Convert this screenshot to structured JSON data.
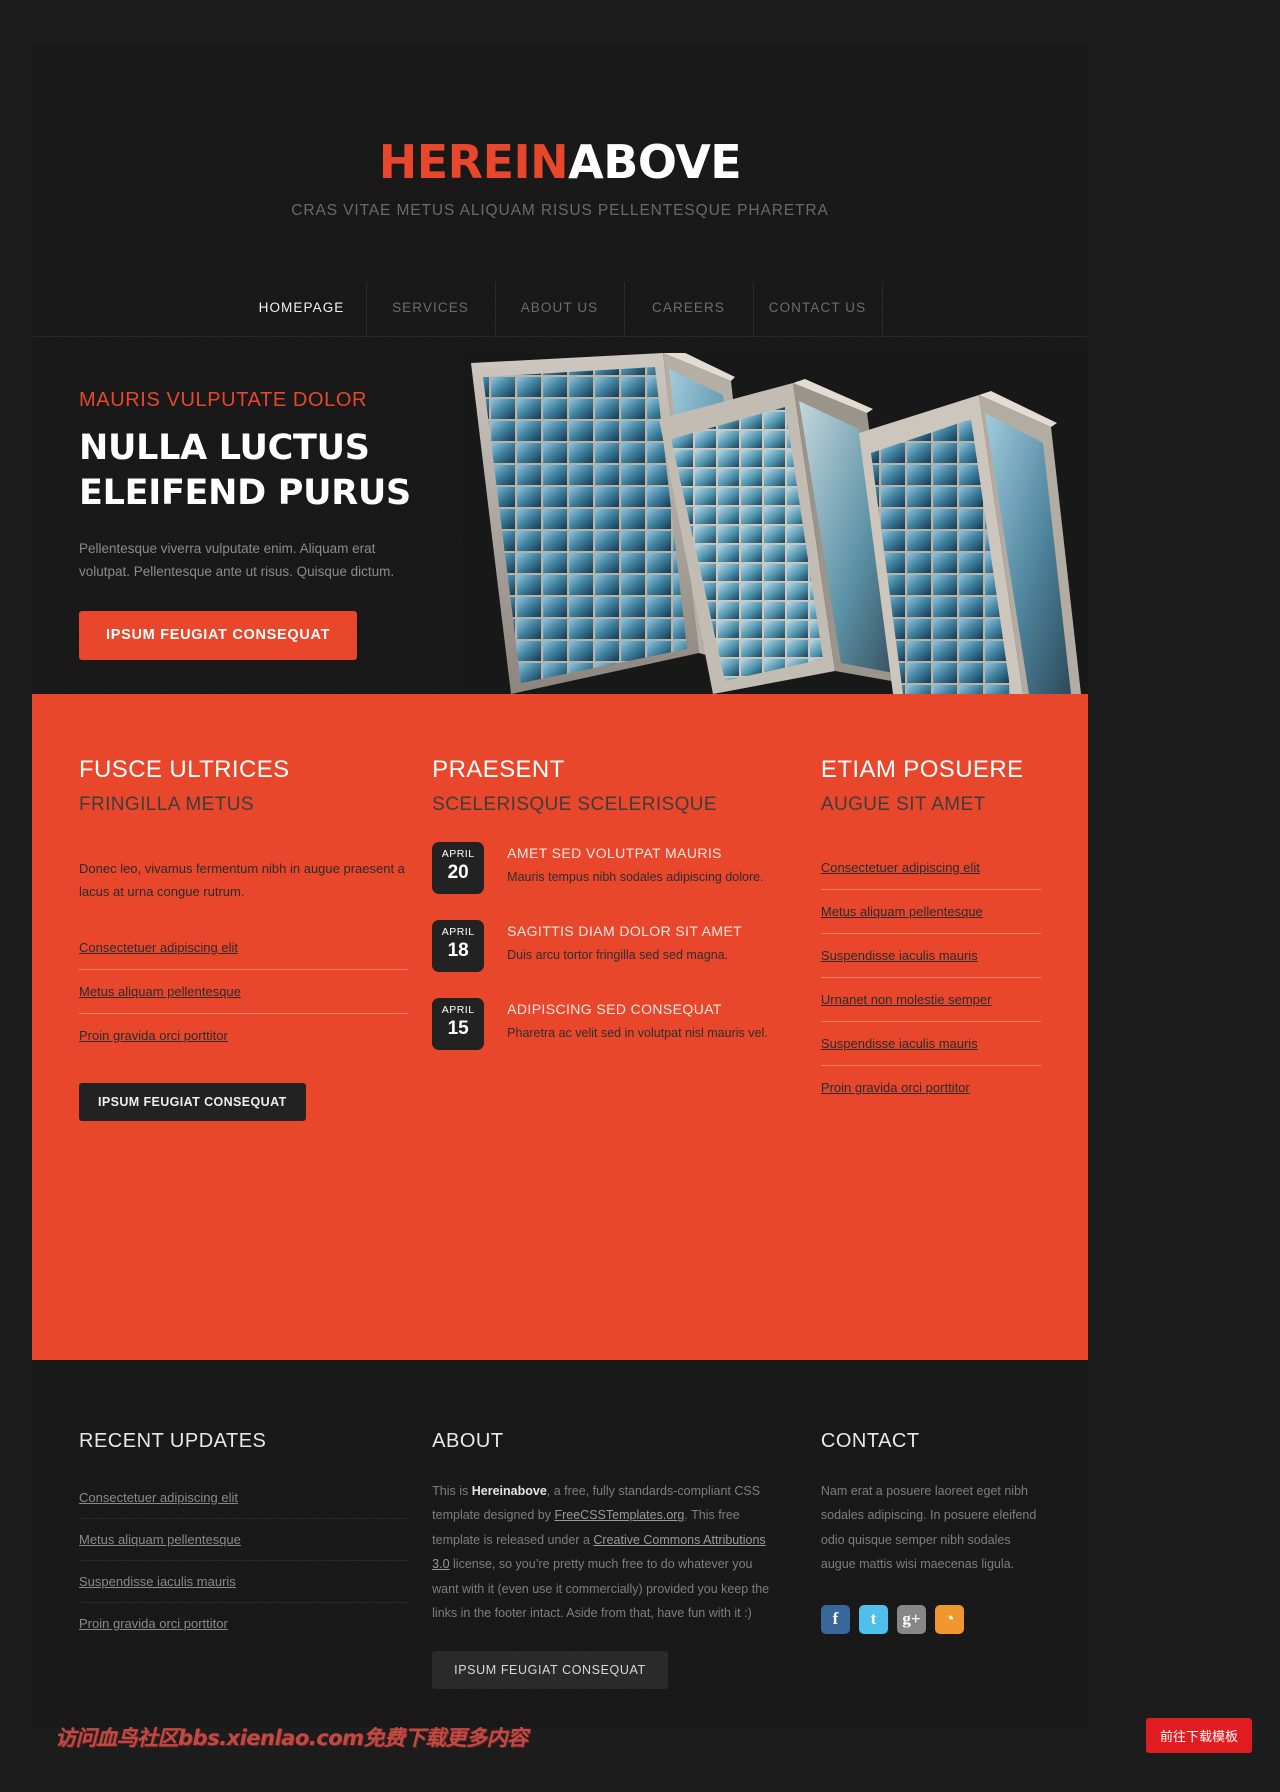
{
  "header": {
    "logo_part1": "HEREIN",
    "logo_part2": "ABOVE",
    "tagline": "CRAS VITAE METUS ALIQUAM RISUS PELLENTESQUE PHARETRA"
  },
  "nav": {
    "items": [
      {
        "label": "HOMEPAGE",
        "active": true
      },
      {
        "label": "SERVICES",
        "active": false
      },
      {
        "label": "ABOUT US",
        "active": false
      },
      {
        "label": "CAREERS",
        "active": false
      },
      {
        "label": "CONTACT US",
        "active": false
      }
    ]
  },
  "hero": {
    "kicker": "MAURIS VULPUTATE DOLOR",
    "title_line1": "NULLA LUCTUS",
    "title_line2": "ELEIFEND PURUS",
    "description": "Pellentesque viverra vulputate enim. Aliquam erat volutpat. Pellentesque ante ut risus. Quisque dictum.",
    "cta_label": "IPSUM FEUGIAT CONSEQUAT",
    "image_alt": "high-rise-office-buildings-photo"
  },
  "band": {
    "col1": {
      "heading": "FUSCE ULTRICES",
      "subheading": "FRINGILLA METUS",
      "paragraph": "Donec leo, vivamus fermentum nibh in augue praesent a lacus at urna congue rutrum.",
      "links": [
        "Consectetuer adipiscing elit",
        "Metus aliquam pellentesque",
        "Proin gravida orci porttitor"
      ],
      "button_label": "IPSUM FEUGIAT CONSEQUAT"
    },
    "col2": {
      "heading": "PRAESENT",
      "subheading": "SCELERISQUE SCELERISQUE",
      "posts": [
        {
          "month": "APRIL",
          "day": "20",
          "title": "AMET SED VOLUTPAT MAURIS",
          "desc": "Mauris tempus nibh sodales adipiscing dolore."
        },
        {
          "month": "APRIL",
          "day": "18",
          "title": "SAGITTIS DIAM DOLOR SIT AMET",
          "desc": "Duis arcu tortor fringilla sed sed magna."
        },
        {
          "month": "APRIL",
          "day": "15",
          "title": "ADIPISCING SED CONSEQUAT",
          "desc": "Pharetra ac velit sed in volutpat nisl mauris vel."
        }
      ]
    },
    "col3": {
      "heading": "ETIAM POSUERE",
      "subheading": "AUGUE SIT AMET",
      "links": [
        "Consectetuer adipiscing elit",
        "Metus aliquam pellentesque",
        "Suspendisse iaculis mauris",
        "Urnanet non molestie semper",
        "Suspendisse iaculis mauris",
        "Proin gravida orci porttitor"
      ]
    }
  },
  "footer": {
    "recent": {
      "heading": "RECENT UPDATES",
      "links": [
        "Consectetuer adipiscing elit",
        "Metus aliquam pellentesque",
        "Suspendisse iaculis mauris",
        "Proin gravida orci porttitor"
      ]
    },
    "about": {
      "heading": "ABOUT",
      "text_1": "This is ",
      "brand": "Hereinabove",
      "text_2": ", a free, fully standards-compliant CSS template designed by ",
      "link_1": "FreeCSSTemplates.org",
      "text_3": ". This free template is released under a ",
      "link_2": "Creative Commons Attributions 3.0",
      "text_4": " license, so you’re pretty much free to do whatever you want with it (even use it commercially) provided you keep the links in the footer intact. Aside from that, have fun with it :)",
      "button_label": "IPSUM FEUGIAT CONSEQUAT"
    },
    "contact": {
      "heading": "CONTACT",
      "text": "Nam erat a posuere laoreet eget nibh sodales adipiscing. In posuere eleifend odio quisque semper nibh sodales augue mattis wisi maecenas ligula.",
      "socials": [
        {
          "name": "facebook",
          "glyph": "f",
          "color": "#39679b"
        },
        {
          "name": "twitter",
          "glyph": "t",
          "color": "#4fc0ec"
        },
        {
          "name": "googleplus",
          "glyph": "g+",
          "color": "#878787"
        },
        {
          "name": "rss",
          "glyph": "◔",
          "color": "#f0962e"
        }
      ]
    }
  },
  "overlay": {
    "watermark": "访问血鸟社区bbs.xienlao.com免费下载更多内容",
    "download_badge": "前往下载模板"
  }
}
